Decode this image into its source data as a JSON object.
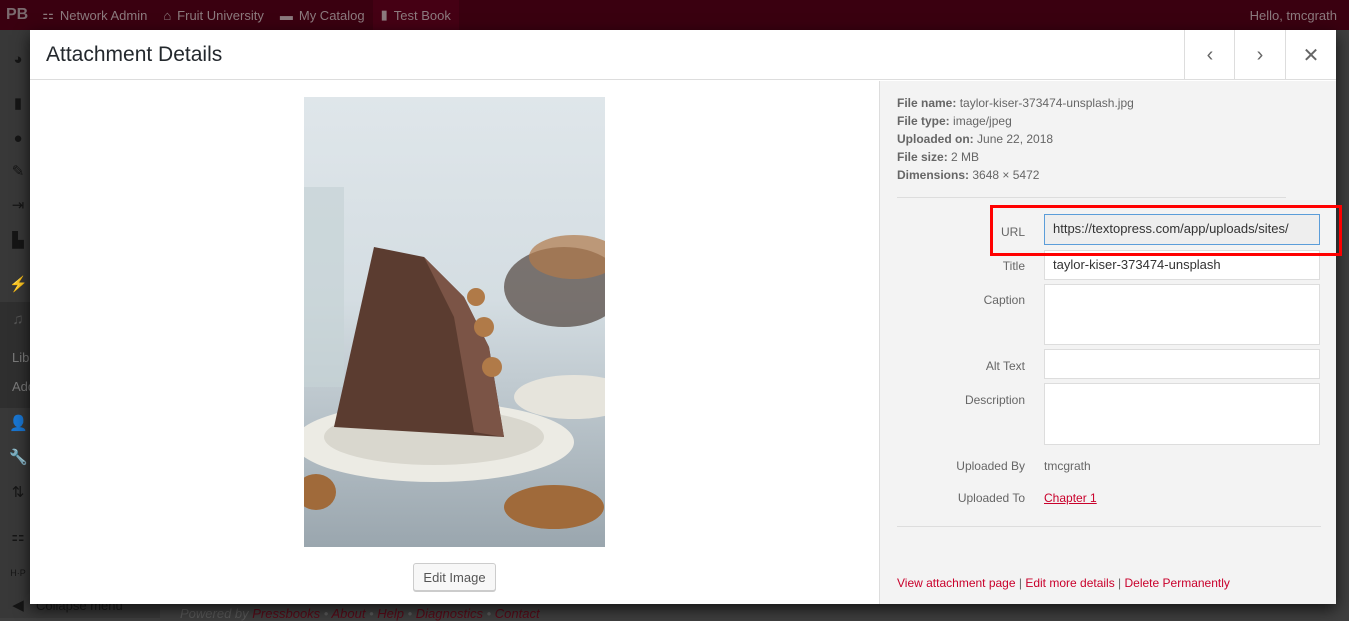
{
  "topbar": {
    "logo": "PB",
    "items": [
      {
        "icon": "network-icon",
        "label": "Network Admin"
      },
      {
        "icon": "home-icon",
        "label": "Fruit University"
      },
      {
        "icon": "folder-icon",
        "label": "My Catalog"
      },
      {
        "icon": "book-icon",
        "label": "Test Book"
      }
    ],
    "greeting": "Hello, tmcgrath"
  },
  "sidebar": {
    "sub_items": [
      "Lib",
      "Add"
    ],
    "collapse": "Collapse menu"
  },
  "footer": {
    "powered": "Powered by ",
    "pressbooks": "Pressbooks",
    "links": [
      "About",
      "Help",
      "Diagnostics",
      "Contact"
    ]
  },
  "modal": {
    "title": "Attachment Details",
    "edit_image": "Edit Image",
    "meta": [
      {
        "k": "File name:",
        "v": "taylor-kiser-373474-unsplash.jpg"
      },
      {
        "k": "File type:",
        "v": "image/jpeg"
      },
      {
        "k": "Uploaded on:",
        "v": "June 22, 2018"
      },
      {
        "k": "File size:",
        "v": "2 MB"
      },
      {
        "k": "Dimensions:",
        "v": "3648 × 5472"
      }
    ],
    "fields": {
      "url_label": "URL",
      "url": "https://textopress.com/app/uploads/sites/",
      "title_label": "Title",
      "title": "taylor-kiser-373474-unsplash",
      "caption_label": "Caption",
      "caption": "",
      "alt_label": "Alt Text",
      "alt": "",
      "description_label": "Description",
      "description": "",
      "uploaded_by_label": "Uploaded By",
      "uploaded_by": "tmcgrath",
      "uploaded_to_label": "Uploaded To",
      "uploaded_to": "Chapter 1"
    },
    "actions": [
      "View attachment page",
      "Edit more details",
      "Delete Permanently"
    ]
  },
  "colors": {
    "accent": "#c9002b",
    "highlight": "#ff0000",
    "topbar": "#3a0010"
  }
}
